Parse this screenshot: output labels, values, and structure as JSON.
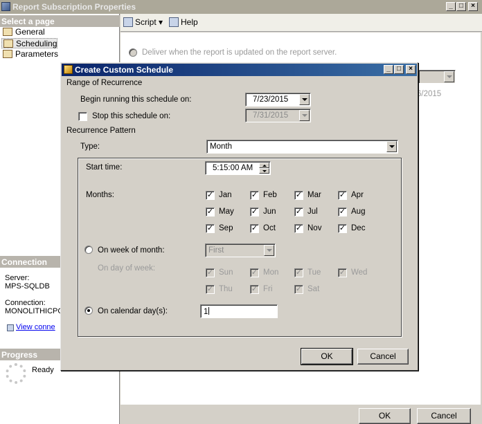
{
  "bg_window": {
    "title": "Report Subscription Properties",
    "select_page_header": "Select a page",
    "pages": [
      "General",
      "Scheduling",
      "Parameters"
    ],
    "selected_page": "Scheduling",
    "toolbar": {
      "script_label": "Script",
      "help_label": "Help"
    },
    "deliver_option": "Deliver when the report is updated on the report server.",
    "partial_date_text": "6/2015",
    "connection_header": "Connection",
    "server_label": "Server:",
    "server_value": "MPS-SQLDB",
    "connection_label": "Connection:",
    "connection_value": "MONOLITHICPC",
    "view_connection_link": "View conne",
    "progress_header": "Progress",
    "progress_status": "Ready",
    "ok_label": "OK",
    "cancel_label": "Cancel"
  },
  "dialog": {
    "title": "Create Custom Schedule",
    "range_header": "Range of Recurrence",
    "begin_label": "Begin running this schedule on:",
    "begin_value": "7/23/2015",
    "stop_label": "Stop this schedule on:",
    "stop_value": "7/31/2015",
    "stop_checked": false,
    "pattern_header": "Recurrence Pattern",
    "type_label": "Type:",
    "type_value": "Month",
    "start_time_label": "Start time:",
    "start_time_value": "5:15:00 AM",
    "months_label": "Months:",
    "months": [
      {
        "name": "Jan",
        "checked": true
      },
      {
        "name": "Feb",
        "checked": true
      },
      {
        "name": "Mar",
        "checked": true
      },
      {
        "name": "Apr",
        "checked": true
      },
      {
        "name": "May",
        "checked": true
      },
      {
        "name": "Jun",
        "checked": true
      },
      {
        "name": "Jul",
        "checked": true
      },
      {
        "name": "Aug",
        "checked": true
      },
      {
        "name": "Sep",
        "checked": true
      },
      {
        "name": "Oct",
        "checked": true
      },
      {
        "name": "Nov",
        "checked": true
      },
      {
        "name": "Dec",
        "checked": true
      }
    ],
    "week_of_month_label": "On week of month:",
    "week_of_month_value": "First",
    "day_of_week_label": "On day of week:",
    "days": [
      {
        "name": "Sun",
        "checked": true
      },
      {
        "name": "Mon",
        "checked": true
      },
      {
        "name": "Tue",
        "checked": true
      },
      {
        "name": "Wed",
        "checked": true
      },
      {
        "name": "Thu",
        "checked": true
      },
      {
        "name": "Fri",
        "checked": true
      },
      {
        "name": "Sat",
        "checked": true
      }
    ],
    "calendar_days_label": "On calendar day(s):",
    "calendar_days_value": "1",
    "ok_label": "OK",
    "cancel_label": "Cancel"
  }
}
